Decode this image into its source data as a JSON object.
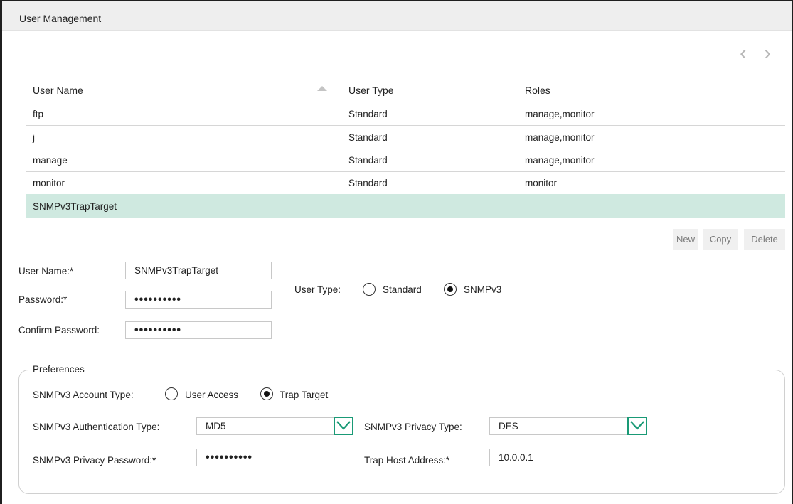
{
  "window": {
    "title": "User Management"
  },
  "nav": {
    "prev_icon": "‹",
    "next_icon": "›"
  },
  "table": {
    "columns": [
      "User Name",
      "User Type",
      "Roles"
    ],
    "rows": [
      {
        "name": "ftp",
        "type": "Standard",
        "roles": "manage,monitor"
      },
      {
        "name": "j",
        "type": "Standard",
        "roles": "manage,monitor"
      },
      {
        "name": "manage",
        "type": "Standard",
        "roles": "manage,monitor"
      },
      {
        "name": "monitor",
        "type": "Standard",
        "roles": "monitor"
      },
      {
        "name": "SNMPv3TrapTarget",
        "type": "",
        "roles": ""
      }
    ],
    "selected_index": 4
  },
  "actions": {
    "new": "New",
    "copy": "Copy",
    "delete": "Delete"
  },
  "form": {
    "user_name_label": "User Name:*",
    "user_name_value": "SNMPv3TrapTarget",
    "password_label": "Password:*",
    "password_value": "••••••••••",
    "confirm_label": "Confirm Password:",
    "confirm_value": "••••••••••",
    "user_type_label": "User Type:",
    "user_type_options": [
      "Standard",
      "SNMPv3"
    ],
    "user_type_selected": "SNMPv3"
  },
  "preferences": {
    "legend": "Preferences",
    "account_type_label": "SNMPv3 Account Type:",
    "account_type_options": [
      "User Access",
      "Trap Target"
    ],
    "account_type_selected": "Trap Target",
    "auth_type_label": "SNMPv3 Authentication Type:",
    "auth_type_value": "MD5",
    "privacy_type_label": "SNMPv3 Privacy Type:",
    "privacy_type_value": "DES",
    "privacy_password_label": "SNMPv3 Privacy Password:*",
    "privacy_password_value": "••••••••••",
    "trap_host_label": "Trap Host Address:*",
    "trap_host_value": "10.0.0.1"
  },
  "colors": {
    "selected_row": "#cfe9e0",
    "accent": "#1a9a76"
  }
}
